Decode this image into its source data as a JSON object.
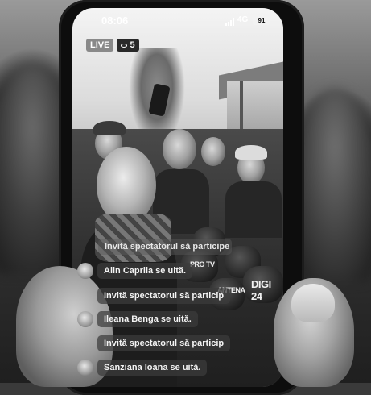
{
  "status_bar": {
    "time": "08:06",
    "network": "4G",
    "battery": "91"
  },
  "live": {
    "badge": "LIVE",
    "viewer_count": "5"
  },
  "overlay": {
    "items": [
      {
        "text": "Invită spectatorul să participe",
        "type": "invite"
      },
      {
        "text": "Alin Caprila se uită.",
        "type": "viewer"
      },
      {
        "text": "Invită spectatorul să particip",
        "type": "invite"
      },
      {
        "text": "Ileana Benga se uită.",
        "type": "viewer"
      },
      {
        "text": "Invită spectatorul să particip",
        "type": "invite"
      },
      {
        "text": "Sanziana Ioana se uită.",
        "type": "viewer"
      }
    ]
  },
  "microphones": {
    "labels": [
      "PRO TV",
      "DIGI 24",
      "ANTENA"
    ]
  },
  "colors": {
    "grayscale_photo": true,
    "overlay_pill": "#3c3c3c"
  }
}
